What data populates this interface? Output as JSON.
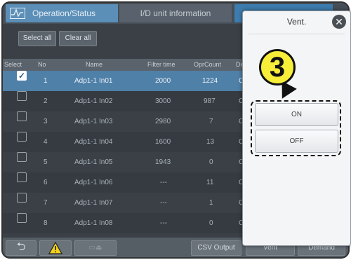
{
  "header": {
    "tab1_label": "Operation/Status",
    "tab2_label": "I/D unit information"
  },
  "toolbar": {
    "select_all": "Select all",
    "clear_all": "Clear all"
  },
  "table": {
    "columns": [
      "Select",
      "No",
      "Name",
      "Filter time",
      "OprCount",
      "De"
    ],
    "rows": [
      {
        "no": "1",
        "name": "Adp1-1 In01",
        "filter": "2000",
        "opr": "1224",
        "de": "C",
        "checked": true
      },
      {
        "no": "2",
        "name": "Adp1-1 In02",
        "filter": "3000",
        "opr": "987",
        "de": "C",
        "checked": false
      },
      {
        "no": "3",
        "name": "Adp1-1 In03",
        "filter": "2980",
        "opr": "7",
        "de": "C",
        "checked": false
      },
      {
        "no": "4",
        "name": "Adp1-1 In04",
        "filter": "1600",
        "opr": "13",
        "de": "C",
        "checked": false
      },
      {
        "no": "5",
        "name": "Adp1-1 In05",
        "filter": "1943",
        "opr": "0",
        "de": "C",
        "checked": false
      },
      {
        "no": "6",
        "name": "Adp1-1 In06",
        "filter": "---",
        "opr": "11",
        "de": "C",
        "checked": false
      },
      {
        "no": "7",
        "name": "Adp1-1 In07",
        "filter": "---",
        "opr": "1",
        "de": "C",
        "checked": false
      },
      {
        "no": "8",
        "name": "Adp1-1 In08",
        "filter": "---",
        "opr": "0",
        "de": "C",
        "checked": false
      }
    ]
  },
  "footer": {
    "csv_output": "CSV Output",
    "vent": "Vent",
    "demand": "Demand"
  },
  "popup": {
    "title": "Vent.",
    "on_label": "ON",
    "off_label": "OFF",
    "callout_number": "3"
  },
  "colors": {
    "selected_row": "#4f80a8",
    "callout_fill": "#f7ee3a"
  }
}
